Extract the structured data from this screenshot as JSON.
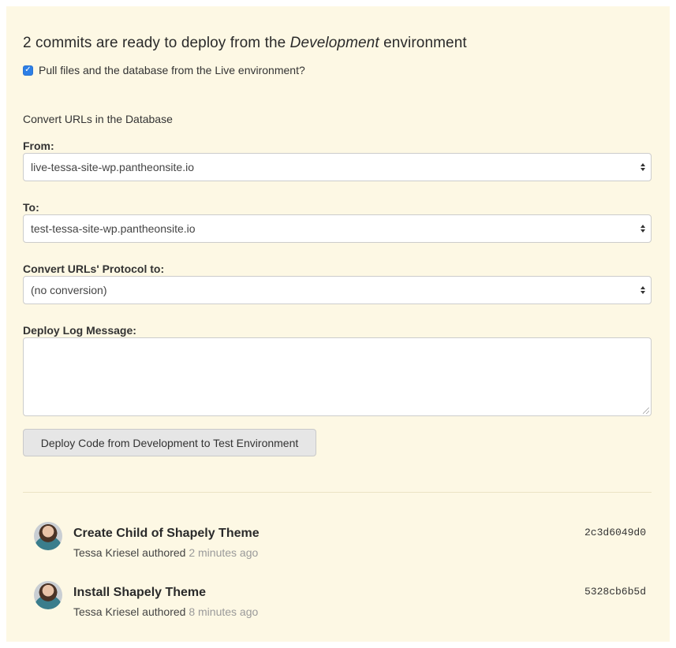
{
  "heading": {
    "prefix": "2 commits are ready to deploy from the ",
    "env": "Development",
    "suffix": " environment"
  },
  "pull_checkbox": {
    "checked": true,
    "label": "Pull files and the database from the Live environment?"
  },
  "convert_section_title": "Convert URLs in the Database",
  "from": {
    "label": "From:",
    "value": "live-tessa-site-wp.pantheonsite.io"
  },
  "to": {
    "label": "To:",
    "value": "test-tessa-site-wp.pantheonsite.io"
  },
  "protocol": {
    "label": "Convert URLs' Protocol to:",
    "value": "(no conversion)"
  },
  "log_message": {
    "label": "Deploy Log Message:",
    "value": ""
  },
  "deploy_button": "Deploy Code from Development to Test Environment",
  "commits": [
    {
      "title": "Create Child of Shapely Theme",
      "author": "Tessa Kriesel",
      "verb": " authored ",
      "ago": "2 minutes ago",
      "hash": "2c3d6049d0"
    },
    {
      "title": "Install Shapely Theme",
      "author": "Tessa Kriesel",
      "verb": " authored ",
      "ago": "8 minutes ago",
      "hash": "5328cb6b5d"
    }
  ],
  "colors": {
    "panel_bg": "#fdf8e4",
    "checkbox": "#2d7fe6",
    "button_bg": "#e6e6e6"
  },
  "icons": {
    "avatar": "user-avatar",
    "select_arrows": "up-down-arrows-icon"
  }
}
